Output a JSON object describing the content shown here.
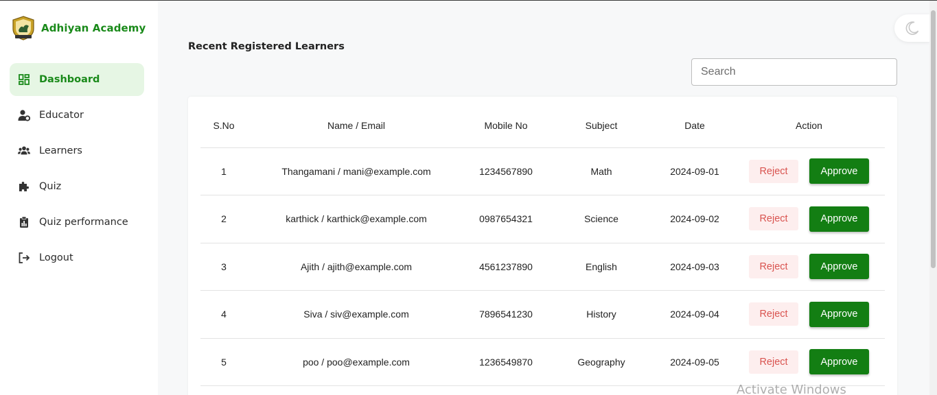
{
  "brand": {
    "name": "Adhiyan Academy"
  },
  "sidebar": {
    "items": [
      {
        "label": "Dashboard",
        "icon": "dashboard-icon",
        "active": true
      },
      {
        "label": "Educator",
        "icon": "user-gear-icon"
      },
      {
        "label": "Learners",
        "icon": "users-icon"
      },
      {
        "label": "Quiz",
        "icon": "puzzle-icon"
      },
      {
        "label": "Quiz performance",
        "icon": "clipboard-chart-icon"
      },
      {
        "label": "Logout",
        "icon": "logout-icon"
      }
    ]
  },
  "main": {
    "title": "Recent Registered Learners",
    "search": {
      "placeholder": "Search",
      "value": ""
    },
    "table": {
      "headers": [
        "S.No",
        "Name / Email",
        "Mobile No",
        "Subject",
        "Date",
        "Action"
      ],
      "rows": [
        {
          "sno": "1",
          "name_email": "Thangamani / mani@example.com",
          "mobile": "1234567890",
          "subject": "Math",
          "date": "2024-09-01"
        },
        {
          "sno": "2",
          "name_email": "karthick / karthick@example.com",
          "mobile": "0987654321",
          "subject": "Science",
          "date": "2024-09-02"
        },
        {
          "sno": "3",
          "name_email": "Ajith / ajith@example.com",
          "mobile": "4561237890",
          "subject": "English",
          "date": "2024-09-03"
        },
        {
          "sno": "4",
          "name_email": "Siva / siv@example.com",
          "mobile": "7896541230",
          "subject": "History",
          "date": "2024-09-04"
        },
        {
          "sno": "5",
          "name_email": "poo / poo@example.com",
          "mobile": "1236549870",
          "subject": "Geography",
          "date": "2024-09-05"
        }
      ],
      "reject_label": "Reject",
      "approve_label": "Approve"
    }
  },
  "watermark": "Activate Windows",
  "colors": {
    "brand": "#1a8a1a",
    "approve": "#137e13",
    "reject_text": "#d9534f",
    "reject_bg": "#fdeeee",
    "active_nav_bg": "#e6f6e4"
  }
}
